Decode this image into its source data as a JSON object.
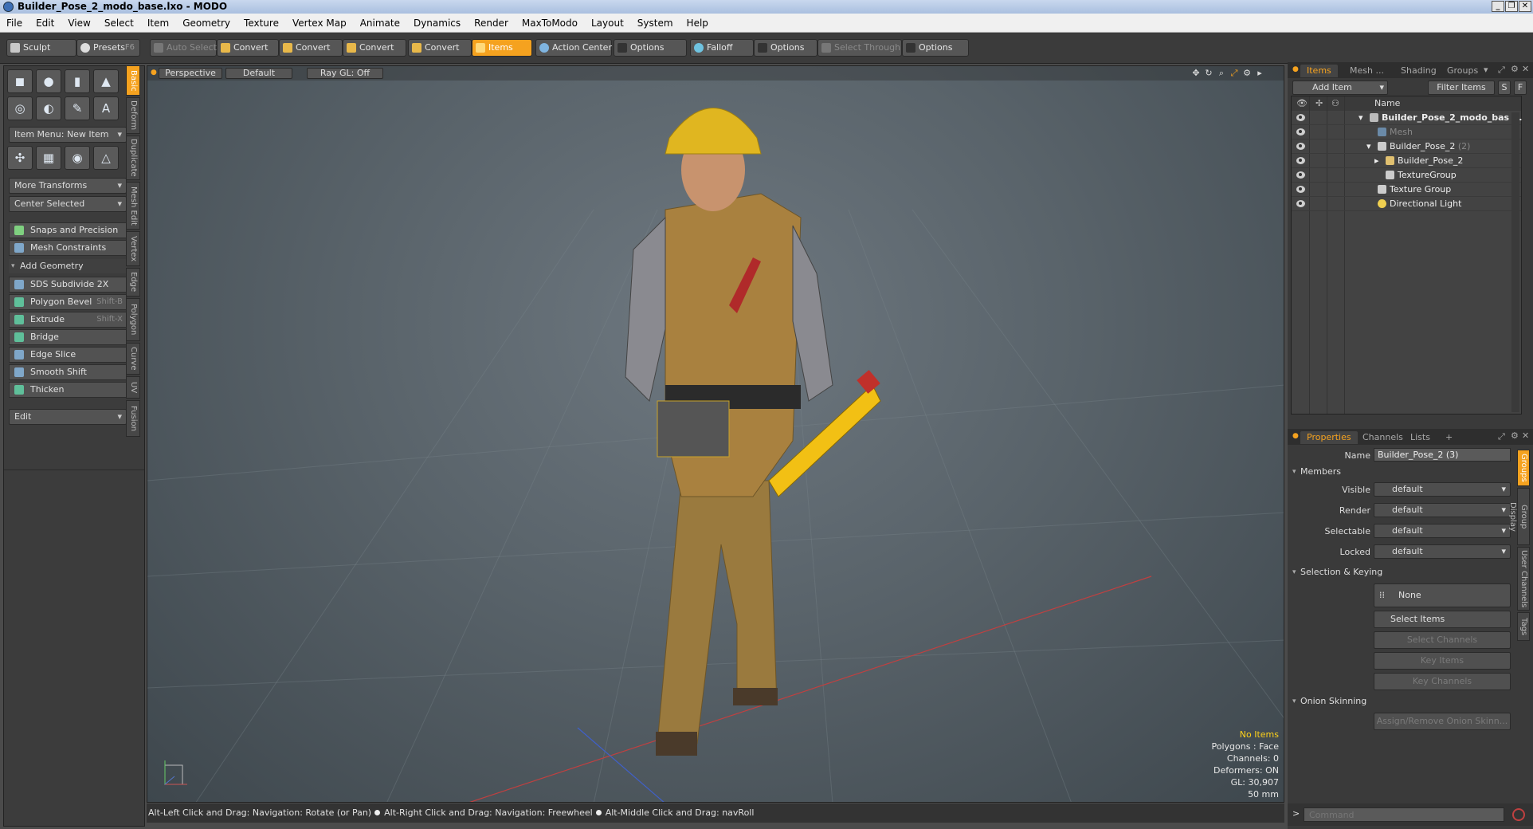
{
  "window": {
    "title": "Builder_Pose_2_modo_base.lxo - MODO",
    "min": "_",
    "max": "❐",
    "close": "✕"
  },
  "menu": [
    "File",
    "Edit",
    "View",
    "Select",
    "Item",
    "Geometry",
    "Texture",
    "Vertex Map",
    "Animate",
    "Dynamics",
    "Render",
    "MaxToModo",
    "Layout",
    "System",
    "Help"
  ],
  "toolbar": {
    "sculpt": "Sculpt",
    "presets": "Presets",
    "presets_key": "F6",
    "auto_select": "Auto Select",
    "convert1": "Convert",
    "convert2": "Convert",
    "convert3": "Convert",
    "convert4": "Convert",
    "items": "Items",
    "action_center": "Action Center",
    "options1": "Options",
    "falloff": "Falloff",
    "options2": "Options",
    "select_through": "Select Through",
    "options3": "Options"
  },
  "left": {
    "item_menu": "Item Menu: New Item",
    "more_transforms": "More Transforms",
    "center_selected": "Center Selected",
    "snaps": "Snaps and Precision",
    "mesh_constraints": "Mesh Constraints",
    "add_geometry": "Add Geometry",
    "tools": [
      {
        "label": "SDS Subdivide 2X",
        "key": ""
      },
      {
        "label": "Polygon Bevel",
        "key": "Shift-B"
      },
      {
        "label": "Extrude",
        "key": "Shift-X"
      },
      {
        "label": "Bridge",
        "key": ""
      },
      {
        "label": "Edge Slice",
        "key": ""
      },
      {
        "label": "Smooth Shift",
        "key": ""
      },
      {
        "label": "Thicken",
        "key": ""
      }
    ],
    "edit": "Edit",
    "vtabs": [
      "Basic",
      "Deform",
      "Duplicate",
      "Mesh Edit",
      "Vertex",
      "Edge",
      "Polygon",
      "Curve",
      "UV",
      "Fusion"
    ]
  },
  "viewport": {
    "view": "Perspective",
    "shading": "Default",
    "raygl": "Ray GL: Off",
    "hud": {
      "items": "No Items",
      "polygons": "Polygons : Face",
      "channels": "Channels: 0",
      "deformers": "Deformers: ON",
      "gl": "GL: 30,907",
      "size": "50 mm"
    }
  },
  "status": {
    "hint1": "Alt-Left Click and Drag: Navigation: Rotate (or Pan)",
    "hint2": "Alt-Right Click and Drag: Navigation: Freewheel",
    "hint3": "Alt-Middle Click and Drag: navRoll"
  },
  "items_panel": {
    "tabs": [
      "Items",
      "Mesh ...",
      "Shading",
      "Groups"
    ],
    "add_item": "Add Item",
    "filter_items": "Filter Items",
    "s": "S",
    "f": "F",
    "name_col": "Name",
    "rows": [
      {
        "label": "Builder_Pose_2_modo_bas ...",
        "extra": ""
      },
      {
        "label": "Mesh",
        "extra": ""
      },
      {
        "label": "Builder_Pose_2",
        "extra": "(2)"
      },
      {
        "label": "Builder_Pose_2",
        "extra": ""
      },
      {
        "label": "TextureGroup",
        "extra": ""
      },
      {
        "label": "Texture Group",
        "extra": ""
      },
      {
        "label": "Directional Light",
        "extra": ""
      }
    ]
  },
  "props_panel": {
    "tabs": [
      "Properties",
      "Channels",
      "Lists",
      "+"
    ],
    "name_label": "Name",
    "name_value": "Builder_Pose_2 (3)",
    "members": "Members",
    "fields": [
      {
        "label": "Visible",
        "value": "default"
      },
      {
        "label": "Render",
        "value": "default"
      },
      {
        "label": "Selectable",
        "value": "default"
      },
      {
        "label": "Locked",
        "value": "default"
      }
    ],
    "sel_keying": "Selection & Keying",
    "none": "None",
    "select_items": "Select Items",
    "select_channels": "Select Channels",
    "key_items": "Key Items",
    "key_channels": "Key Channels",
    "onion": "Onion Skinning",
    "assign_onion": "Assign/Remove Onion Skinn...",
    "vtabs": [
      "Groups",
      "Group Display",
      "User Channels",
      "Tags"
    ]
  },
  "command": {
    "prompt": ">",
    "placeholder": "Command"
  }
}
